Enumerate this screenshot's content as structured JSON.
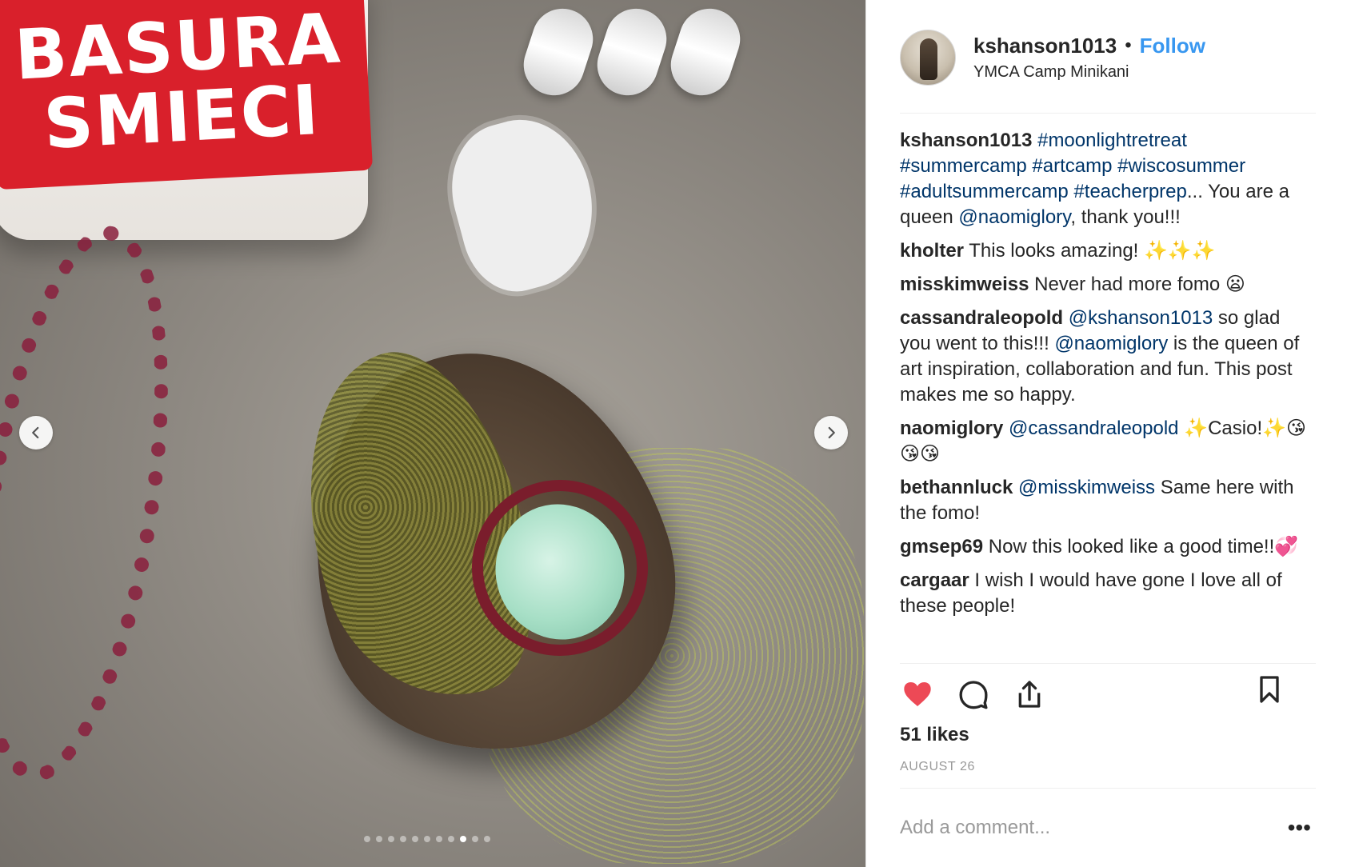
{
  "photo": {
    "jar_label": [
      "BASURA",
      "SMIECI"
    ]
  },
  "carousel": {
    "prev_icon": "chevron-left-icon",
    "next_icon": "chevron-right-icon",
    "dot_count": 11,
    "active_dot_index": 8
  },
  "post": {
    "username": "kshanson1013",
    "bullet": "•",
    "follow_label": "Follow",
    "location": "YMCA Camp Minikani"
  },
  "comments": [
    {
      "user": "kshanson1013",
      "parts": [
        {
          "type": "link",
          "text": "#moonlightretreat"
        },
        {
          "type": "text",
          "text": " "
        },
        {
          "type": "link",
          "text": "#summercamp"
        },
        {
          "type": "text",
          "text": " "
        },
        {
          "type": "link",
          "text": "#artcamp"
        },
        {
          "type": "text",
          "text": " "
        },
        {
          "type": "link",
          "text": "#wiscosummer"
        },
        {
          "type": "text",
          "text": " "
        },
        {
          "type": "link",
          "text": "#adultsummercamp"
        },
        {
          "type": "text",
          "text": " "
        },
        {
          "type": "link",
          "text": "#teacherprep"
        },
        {
          "type": "text",
          "text": "... You are a queen "
        },
        {
          "type": "link",
          "text": "@naomiglory"
        },
        {
          "type": "text",
          "text": ", thank you!!!"
        }
      ]
    },
    {
      "user": "kholter",
      "parts": [
        {
          "type": "text",
          "text": "This looks amazing! ✨✨✨"
        }
      ]
    },
    {
      "user": "misskimweiss",
      "parts": [
        {
          "type": "text",
          "text": "Never had more fomo 😦"
        }
      ]
    },
    {
      "user": "cassandraleopold",
      "parts": [
        {
          "type": "link",
          "text": "@kshanson1013"
        },
        {
          "type": "text",
          "text": " so glad you went to this!!! "
        },
        {
          "type": "link",
          "text": "@naomiglory"
        },
        {
          "type": "text",
          "text": " is the queen of art inspiration, collaboration and fun. This post makes me so happy."
        }
      ]
    },
    {
      "user": "naomiglory",
      "parts": [
        {
          "type": "link",
          "text": "@cassandraleopold"
        },
        {
          "type": "text",
          "text": " ✨Casio!✨😘😘😘"
        }
      ]
    },
    {
      "user": "bethannluck",
      "parts": [
        {
          "type": "link",
          "text": "@misskimweiss"
        },
        {
          "type": "text",
          "text": " Same here with the fomo!"
        }
      ]
    },
    {
      "user": "gmsep69",
      "parts": [
        {
          "type": "text",
          "text": "Now this looked like a good time!!💞"
        }
      ]
    },
    {
      "user": "cargaar",
      "parts": [
        {
          "type": "text",
          "text": "I wish I would have gone I love all of these people!"
        }
      ]
    }
  ],
  "actions": {
    "like_icon": "heart-icon",
    "like_color": "#ed4956",
    "comment_icon": "comment-icon",
    "share_icon": "share-icon",
    "save_icon": "bookmark-icon"
  },
  "likes_text": "51 likes",
  "date_text": "AUGUST 26",
  "add_comment": {
    "placeholder": "Add a comment...",
    "more_label": "•••"
  },
  "colors": {
    "link": "#003569",
    "follow": "#3897f0",
    "muted": "#999999"
  }
}
